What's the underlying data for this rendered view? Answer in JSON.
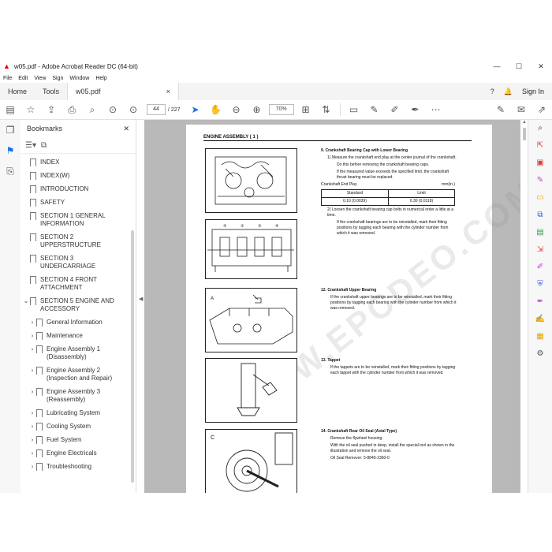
{
  "window": {
    "title": "w05.pdf - Adobe Acrobat Reader DC (64-bit)",
    "minimize": "—",
    "maximize": "☐",
    "close": "✕"
  },
  "menu": [
    "File",
    "Edit",
    "View",
    "Sign",
    "Window",
    "Help"
  ],
  "tabs": {
    "home": "Home",
    "tools": "Tools",
    "doc": "w05.pdf",
    "doc_close": "×",
    "sign_in": "Sign In"
  },
  "toolbar": {
    "page_current": "44",
    "page_total": "/ 227",
    "zoom": "70%"
  },
  "bookmarks": {
    "title": "Bookmarks",
    "close": "✕",
    "items": [
      {
        "label": "INDEX"
      },
      {
        "label": "INDEX(W)"
      },
      {
        "label": "INTRODUCTION"
      },
      {
        "label": "SAFETY"
      },
      {
        "label": "SECTION 1 GENERAL INFORMATION"
      },
      {
        "label": "SECTION 2 UPPERSTRUCTURE"
      },
      {
        "label": "SECTION 3 UNDERCARRIAGE"
      },
      {
        "label": "SECTION 4 FRONT ATTACHMENT"
      },
      {
        "label": "SECTION 5 ENGINE AND ACCESSORY"
      }
    ],
    "children": [
      {
        "label": "General Information"
      },
      {
        "label": "Maintenance"
      },
      {
        "label": "Engine Assembly 1 (Disassembly)"
      },
      {
        "label": "Engine Assembly 2 (Inspection and Repair)"
      },
      {
        "label": "Engine Assembly 3 (Reassembly)"
      },
      {
        "label": "Lubricating System"
      },
      {
        "label": "Cooling System"
      },
      {
        "label": "Fuel System"
      },
      {
        "label": "Engine Electricals"
      },
      {
        "label": "Troubleshooting"
      }
    ]
  },
  "document": {
    "header": "ENGINE ASSEMBLY ( 1 )",
    "watermark": "WWW.EPCDEO.COM",
    "step9": {
      "heading": "9.  Crankshaft Bearing Cap with Lower Bearing",
      "p1": "1)  Measure the crankshaft end play at the center journal of the crankshaft.",
      "p2": "Do this before removing the crankshaft bearing caps.",
      "p3": "If the measured value exceeds the specified limit, the crankshaft thrust bearing must be replaced.",
      "table_title": "Crankshaft End Play",
      "table_unit": "mm(in.)",
      "col1": "Standard",
      "col2": "Limit",
      "val1": "0.10 (0.0039)",
      "val2": "0.30 (0.0118)",
      "p4": "2)  Loosen the crankshaft bearing cap bolts in numerical order a little at a time.",
      "p5": "If the crankshaft bearings are to be reinstalled, mark their fitting positions by tagging each bearing with the cylinder number from which it was removed."
    },
    "step12": {
      "heading": "12.  Crankshaft Upper Bearing",
      "p1": "If the crankshaft upper bearings are to be reinstalled, mark their fitting positions by tagging each bearing with the cylinder number from which it was removed."
    },
    "step13": {
      "heading": "13.  Tappet",
      "p1": "If the tappets are to be reinstalled, mark their fitting positions by tagging each tappet with the cylinder number from which it was removed."
    },
    "step14": {
      "heading": "14.  Crankshaft Rear Oil Seal (Axial Type)",
      "p1": "Remove the flywheel housing.",
      "p2": "With the oil seal pushed in deep, install the special tool as shown in the illustration and remove the oil seal.",
      "p3": "Oil Seal Remover: 5-8840-2360-0"
    },
    "fig5_label": "C"
  }
}
